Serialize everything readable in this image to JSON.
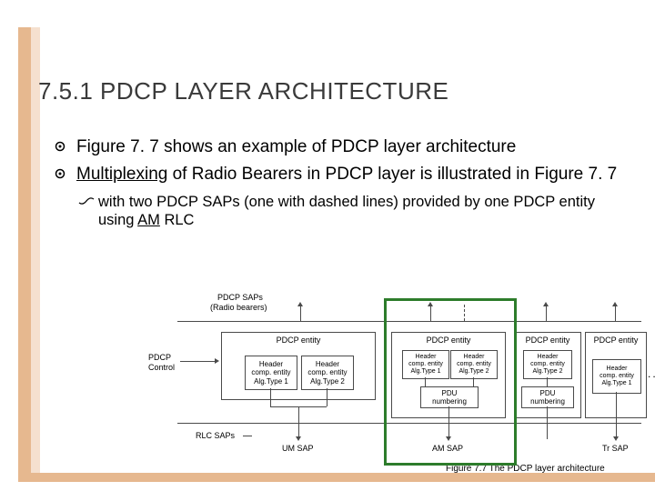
{
  "heading": "7.5.1 PDCP LAYER ARCHITECTURE",
  "bullets": {
    "b1": "Figure 7. 7 shows an example of PDCP layer architecture",
    "b2_pre": "Multiplexing",
    "b2_post": " of Radio Bearers in PDCP layer is illustrated in Figure 7. 7",
    "sub_pre": "with two PDCP SAPs (one with dashed lines) provided by one PDCP entity using ",
    "sub_u": "AM",
    "sub_post": " RLC"
  },
  "fig": {
    "saps": "PDCP SAPs",
    "radio": "(Radio bearers)",
    "pdcp_ctrl_1": "PDCP",
    "pdcp_ctrl_2": "Control",
    "entity": "PDCP entity",
    "hc_alg1": "Header\ncomp. entity\nAlg.Type 1",
    "hc_alg2": "Header\ncomp. entity\nAlg.Type 2",
    "pdu_num": "PDU\nnumbering",
    "rlc_saps": "RLC SAPs",
    "um_sap": "UM SAP",
    "am_sap": "AM SAP",
    "tr_sap": "Tr SAP",
    "dots": "...",
    "caption": "Figure 7.7   The PDCP layer architecture"
  }
}
